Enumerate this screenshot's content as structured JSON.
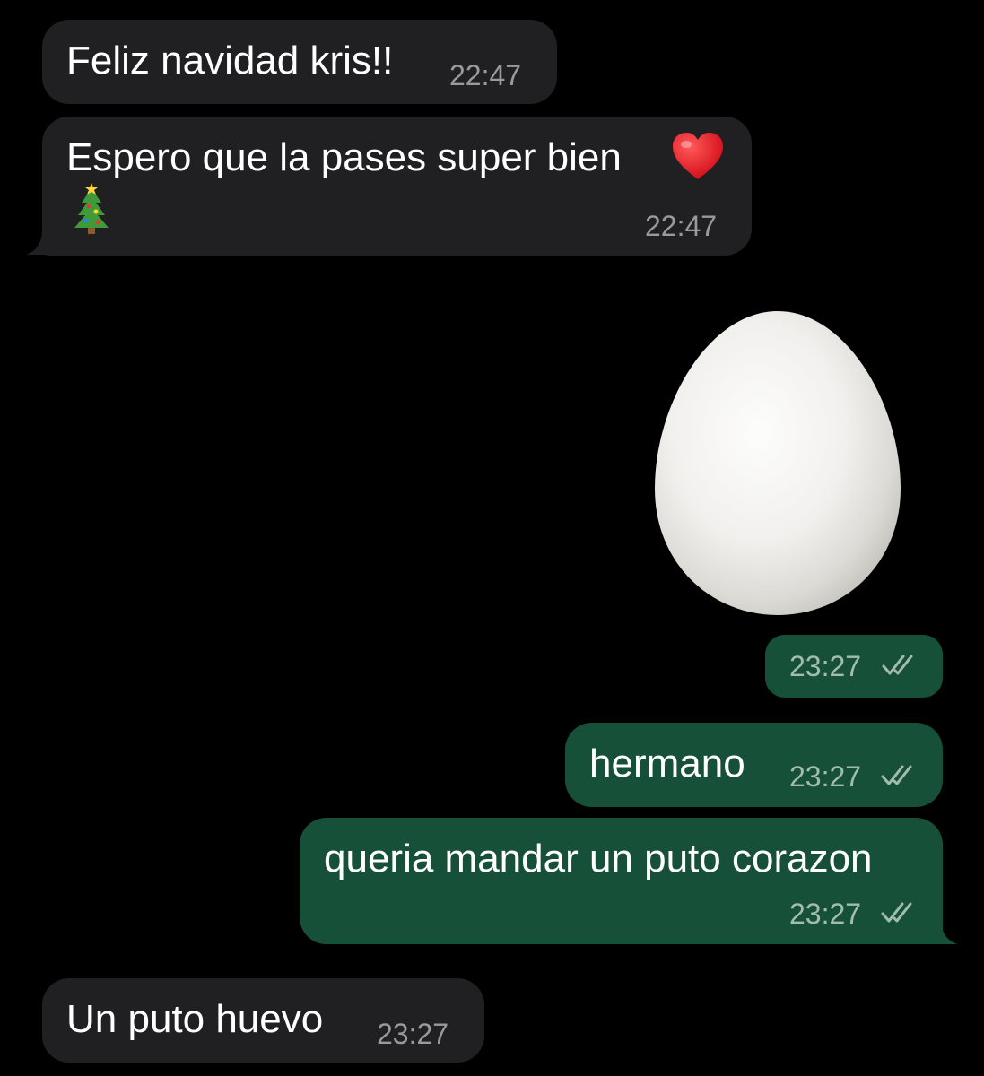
{
  "messages": [
    {
      "direction": "incoming",
      "text": "Feliz navidad kris!!",
      "time": "22:47"
    },
    {
      "direction": "incoming",
      "text": "Espero que la pases super bien",
      "emoji_inline": "heart-emoji",
      "emoji_next_line": "christmas-tree-emoji",
      "time": "22:47"
    },
    {
      "direction": "outgoing",
      "type": "sticker",
      "sticker": "egg",
      "time": "23:27",
      "status": "read"
    },
    {
      "direction": "outgoing",
      "text": "hermano",
      "time": "23:27",
      "status": "read"
    },
    {
      "direction": "outgoing",
      "text": "queria mandar un puto corazon",
      "time": "23:27",
      "status": "read"
    },
    {
      "direction": "incoming",
      "text": "Un puto huevo",
      "time": "23:27"
    }
  ],
  "colors": {
    "background": "#000000",
    "incoming_bubble": "#202022",
    "outgoing_bubble": "#175038",
    "timestamp_incoming": "#9a9a9c",
    "timestamp_outgoing": "#a3bcb0",
    "read_ticks": "#a3bcb0"
  }
}
